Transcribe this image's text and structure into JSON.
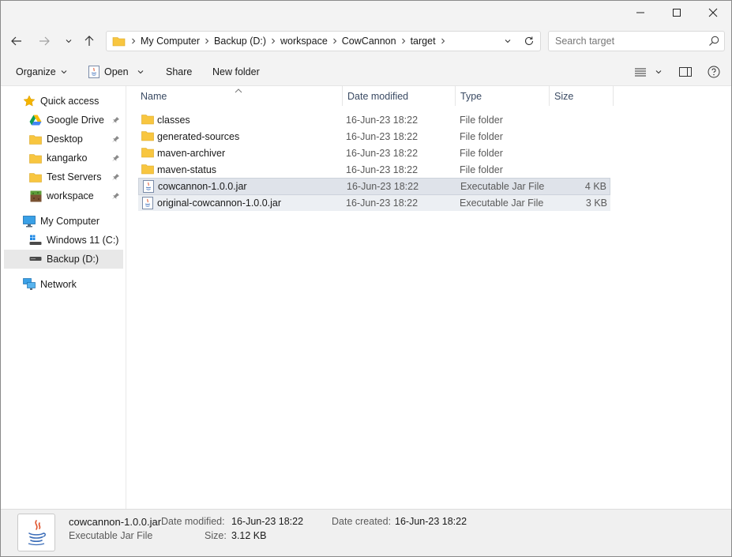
{
  "window": {
    "controls": [
      "minimize",
      "maximize",
      "close"
    ]
  },
  "address": {
    "crumbs": [
      "My Computer",
      "Backup (D:)",
      "workspace",
      "CowCannon",
      "target"
    ]
  },
  "search": {
    "placeholder": "Search target"
  },
  "toolbar": {
    "organize": "Organize",
    "open": "Open",
    "share": "Share",
    "new_folder": "New folder"
  },
  "sidebar": {
    "quick_access": "Quick access",
    "pinned": [
      {
        "label": "Google Drive",
        "icon": "google-drive-icon"
      },
      {
        "label": "Desktop",
        "icon": "folder-icon"
      },
      {
        "label": "kangarko",
        "icon": "folder-icon"
      },
      {
        "label": "Test Servers",
        "icon": "folder-icon"
      },
      {
        "label": "workspace",
        "icon": "minecraft-block-icon"
      }
    ],
    "my_computer": "My Computer",
    "drives": [
      {
        "label": "Windows 11 (C:)",
        "icon": "windows-drive-icon"
      },
      {
        "label": "Backup (D:)",
        "icon": "drive-icon"
      }
    ],
    "network": "Network"
  },
  "columns": {
    "name": "Name",
    "date": "Date modified",
    "type": "Type",
    "size": "Size"
  },
  "files": [
    {
      "name": "classes",
      "date": "16-Jun-23 18:22",
      "type": "File folder",
      "size": "",
      "icon": "folder-icon"
    },
    {
      "name": "generated-sources",
      "date": "16-Jun-23 18:22",
      "type": "File folder",
      "size": "",
      "icon": "folder-icon"
    },
    {
      "name": "maven-archiver",
      "date": "16-Jun-23 18:22",
      "type": "File folder",
      "size": "",
      "icon": "folder-icon"
    },
    {
      "name": "maven-status",
      "date": "16-Jun-23 18:22",
      "type": "File folder",
      "size": "",
      "icon": "folder-icon"
    },
    {
      "name": "cowcannon-1.0.0.jar",
      "date": "16-Jun-23 18:22",
      "type": "Executable Jar File",
      "size": "4 KB",
      "icon": "java-jar-icon"
    },
    {
      "name": "original-cowcannon-1.0.0.jar",
      "date": "16-Jun-23 18:22",
      "type": "Executable Jar File",
      "size": "3 KB",
      "icon": "java-jar-icon"
    }
  ],
  "details": {
    "file_name": "cowcannon-1.0.0.jar",
    "file_type": "Executable Jar File",
    "date_modified_label": "Date modified:",
    "date_modified": "16-Jun-23 18:22",
    "date_created_label": "Date created:",
    "date_created": "16-Jun-23 18:22",
    "size_label": "Size:",
    "size": "3.12 KB"
  },
  "colors": {
    "folder": "#f8c640",
    "selected_row": "#dfe3ea",
    "chrome": "#f3f3f3"
  }
}
